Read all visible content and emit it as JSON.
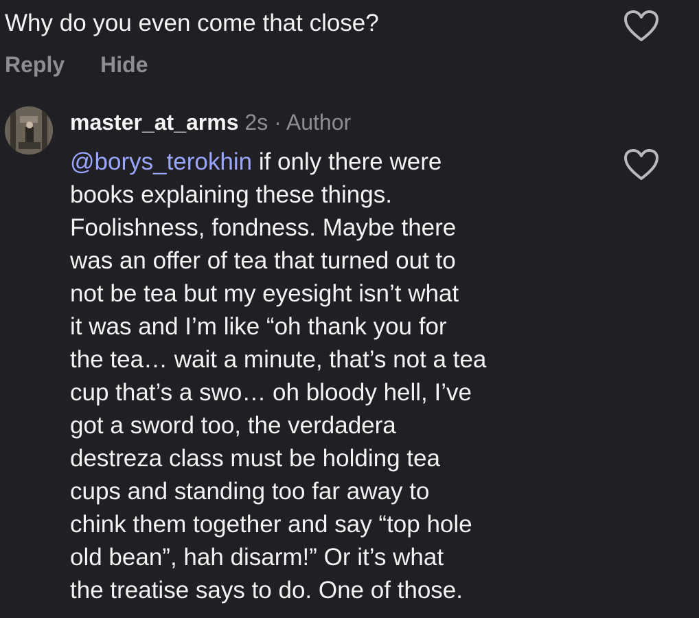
{
  "parent_comment": {
    "text": "Why do you even come that close?",
    "reply_label": "Reply",
    "hide_label": "Hide"
  },
  "reply": {
    "username": "master_at_arms",
    "time": "2s",
    "separator": "·",
    "author_badge": "Author",
    "mention": "@borys_terokhin",
    "lines": [
      " if only there were",
      "books explaining these things.",
      "Foolishness, fondness. Maybe there",
      "was an offer of tea that turned out to",
      "not be tea but my eyesight isn’t what",
      "it was and I’m like “oh thank you for",
      "the tea… wait a minute, that’s not a tea",
      "cup that’s a swo… oh bloody hell, I’ve",
      "got a sword too, the verdadera",
      "destreza class must be holding tea",
      "cups and standing too far away to",
      "chink them together and say “top hole",
      "old bean”, hah disarm!” Or it’s what",
      "the treatise says to do. One of those."
    ]
  },
  "icons": {
    "like": "heart-outline-icon",
    "avatar": "user-avatar"
  },
  "colors": {
    "background": "#202024",
    "text": "#f4f4f4",
    "muted": "#8d8d93",
    "mention": "#9aa6ff"
  }
}
